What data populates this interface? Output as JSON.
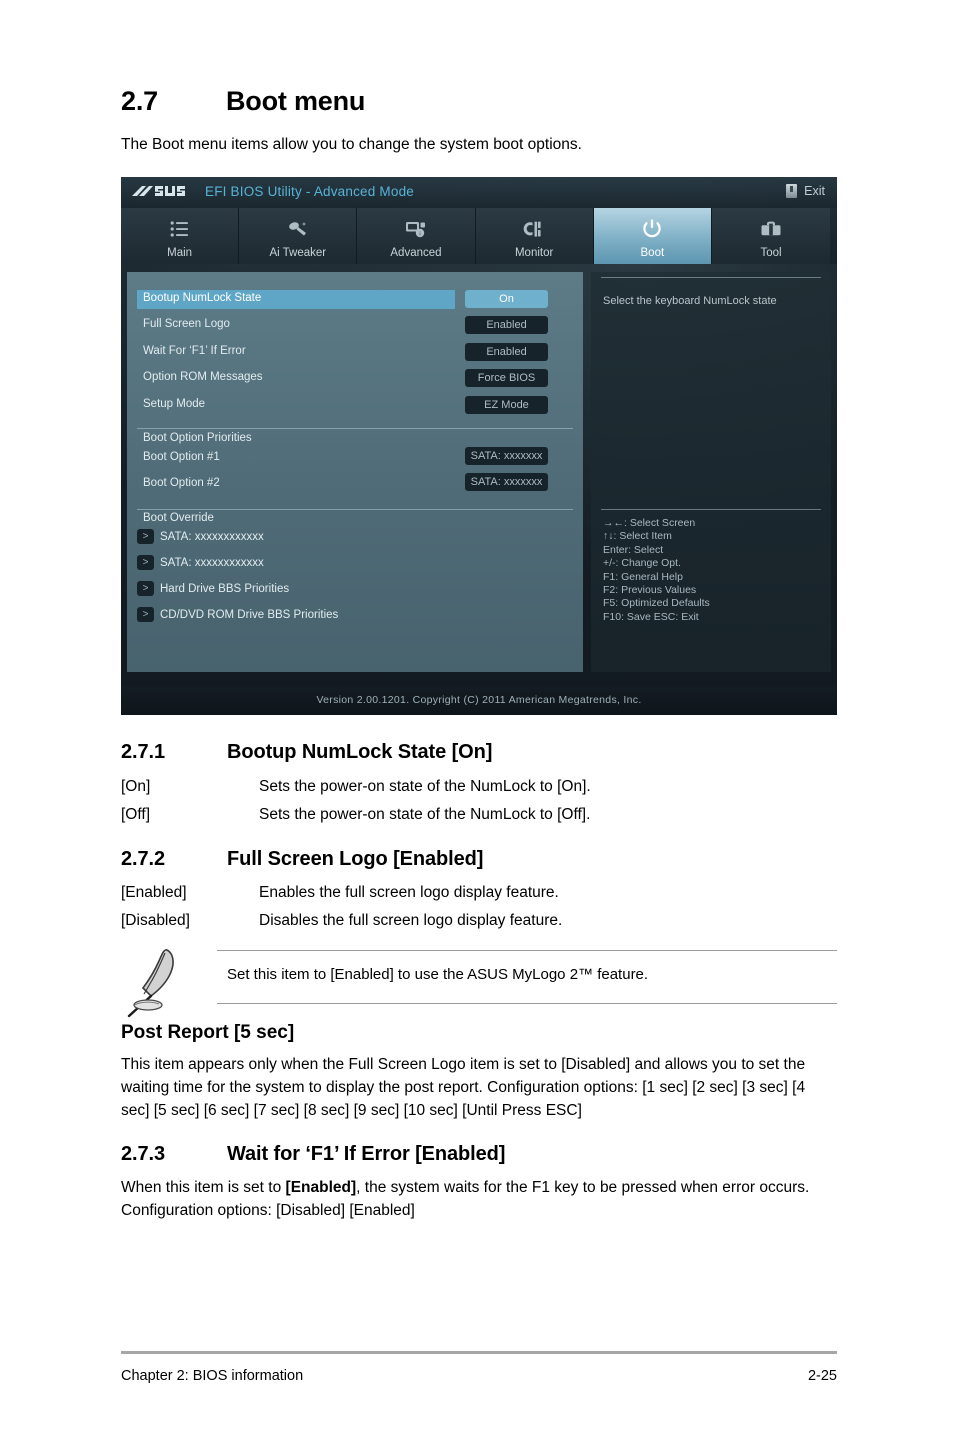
{
  "document": {
    "section_number": "2.7",
    "section_title": "Boot menu",
    "intro": "The Boot menu items allow you to change the system boot options.",
    "subsections": [
      {
        "number": "2.7.1",
        "title": "Bootup NumLock State [On]",
        "options": [
          {
            "key": "[On]",
            "desc": "Sets the power-on state of the NumLock to [On]."
          },
          {
            "key": "[Off]",
            "desc": "Sets the power-on state of the NumLock to [Off]."
          }
        ]
      },
      {
        "number": "2.7.2",
        "title": "Full Screen Logo [Enabled]",
        "options": [
          {
            "key": "[Enabled]",
            "desc": "Enables the full screen logo display feature."
          },
          {
            "key": "[Disabled]",
            "desc": "Disables the full screen logo display feature."
          }
        ]
      }
    ],
    "note": "Set this item to [Enabled] to use the ASUS MyLogo 2™ feature.",
    "post_report": {
      "title": "Post Report [5 sec]",
      "body": "This item appears only when the Full Screen Logo item is set to [Disabled] and allows you to set the waiting time for the system to display the post report. Configuration options: [1 sec] [2 sec] [3 sec] [4 sec] [5 sec] [6 sec] [7 sec] [8 sec] [9 sec] [10 sec] [Until Press ESC]"
    },
    "subsection_f1": {
      "number": "2.7.3",
      "title": "Wait for ‘F1’ If Error [Enabled]",
      "body_pre": "When this item is set to ",
      "body_bold": "[Enabled]",
      "body_post": ", the system waits for the F1 key to be pressed when error occurs. Configuration options: [Disabled] [Enabled]"
    },
    "footer": {
      "left": "Chapter 2: BIOS information",
      "right": "2-25"
    }
  },
  "bios": {
    "titlebar": {
      "logo": "ASUS",
      "title": "EFI BIOS Utility - Advanced Mode",
      "exit_label": "Exit",
      "title_color": "#58b3d9"
    },
    "tabs": [
      {
        "label": "Main",
        "icon": "list-icon",
        "active": false
      },
      {
        "label": "Ai  Tweaker",
        "icon": "tweaker-icon",
        "active": false
      },
      {
        "label": "Advanced",
        "icon": "advanced-icon",
        "active": false
      },
      {
        "label": "Monitor",
        "icon": "monitor-icon",
        "active": false
      },
      {
        "label": "Boot",
        "icon": "power-icon",
        "active": true
      },
      {
        "label": "Tool",
        "icon": "toolbox-icon",
        "active": false
      }
    ],
    "settings": [
      {
        "label": "Bootup NumLock State",
        "value": "On",
        "selected": true
      },
      {
        "label": "Full Screen Logo",
        "value": "Enabled",
        "selected": false
      },
      {
        "label": "Wait For ‘F1’ If Error",
        "value": "Enabled",
        "selected": false
      },
      {
        "label": "Option ROM Messages",
        "value": "Force BIOS",
        "selected": false
      },
      {
        "label": "Setup Mode",
        "value": "EZ Mode",
        "selected": false
      }
    ],
    "boot_priorities": {
      "header": "Boot Option Priorities",
      "items": [
        {
          "label": "Boot Option #1",
          "value": "SATA: xxxxxxx"
        },
        {
          "label": "Boot Option #2",
          "value": "SATA: xxxxxxx"
        }
      ]
    },
    "boot_override": {
      "header": "Boot Override",
      "items": [
        {
          "arrow": ">",
          "label": "SATA: xxxxxxxxxxxx"
        },
        {
          "arrow": ">",
          "label": "SATA: xxxxxxxxxxxx"
        },
        {
          "arrow": ">",
          "label": "Hard Drive BBS Priorities"
        },
        {
          "arrow": ">",
          "label": "CD/DVD ROM Drive BBS Priorities"
        }
      ]
    },
    "help": {
      "description": "Select the keyboard NumLock state",
      "keys": [
        "→←:  Select Screen",
        "↑↓: Select Item",
        "Enter:  Select",
        "+/-:  Change Opt.",
        "F1: General Help",
        "F2: Previous Values",
        "F5: Optimized Defaults",
        "F10: Save    ESC: Exit"
      ]
    },
    "version_bar": "Version  2.00.1201.   Copyright  (C)  2011  American  Megatrends,  Inc."
  }
}
